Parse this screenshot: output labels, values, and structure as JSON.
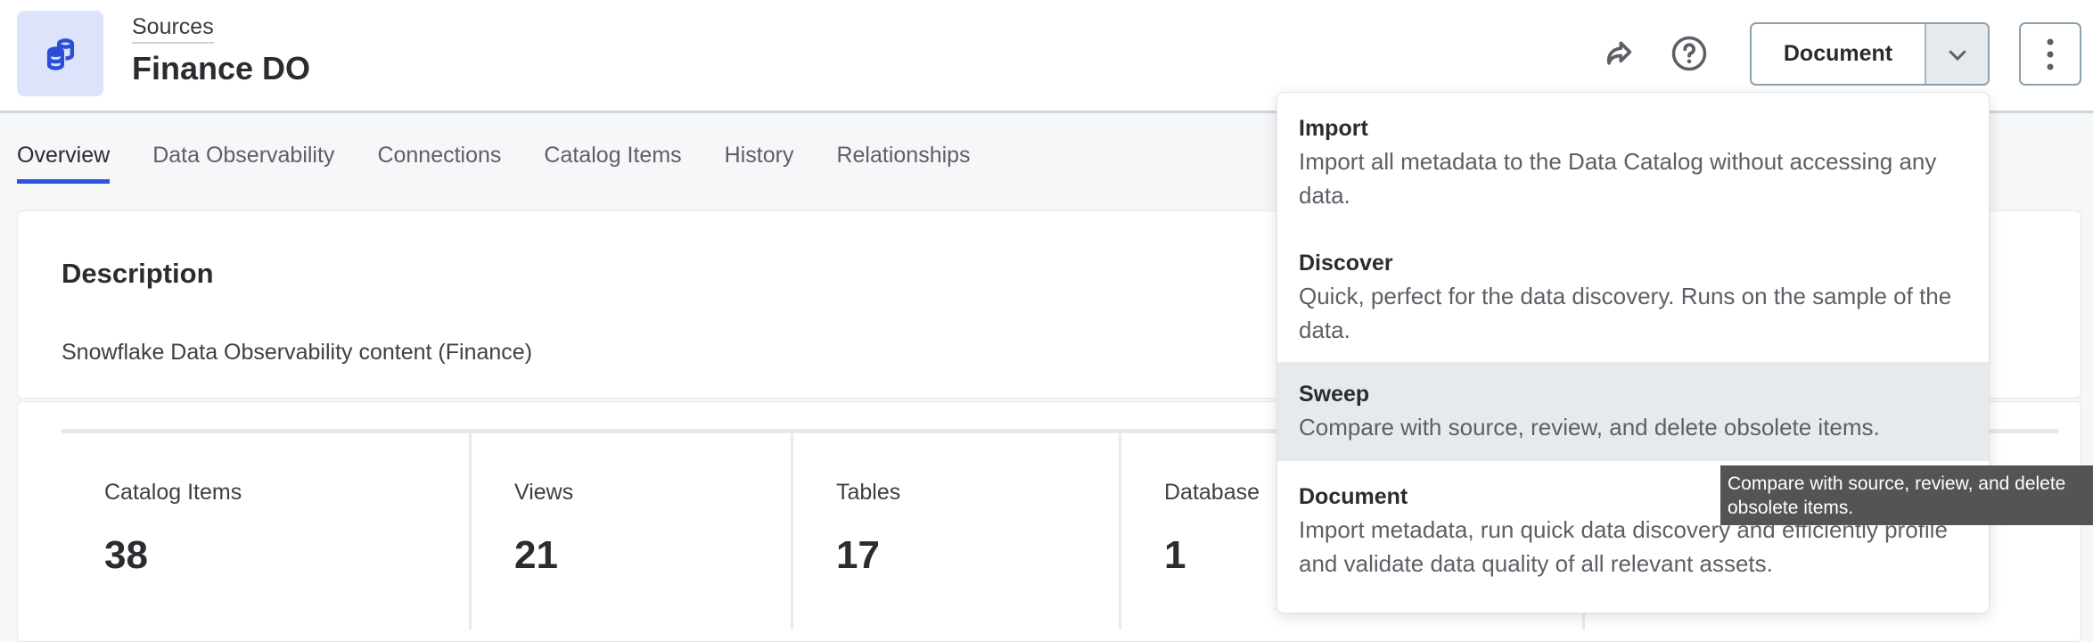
{
  "header": {
    "breadcrumb": "Sources",
    "title": "Finance DO",
    "logo_icon": "database-icon",
    "share_icon": "share-icon",
    "help_icon": "help-icon",
    "primary_action": "Document",
    "more_icon": "kebab-icon"
  },
  "tabs": [
    {
      "label": "Overview",
      "active": true
    },
    {
      "label": "Data Observability"
    },
    {
      "label": "Connections"
    },
    {
      "label": "Catalog Items"
    },
    {
      "label": "History"
    },
    {
      "label": "Relationships"
    }
  ],
  "description": {
    "heading": "Description",
    "text": "Snowflake Data Observability content (Finance)"
  },
  "stats": [
    {
      "label": "Catalog Items",
      "value": "38"
    },
    {
      "label": "Views",
      "value": "21"
    },
    {
      "label": "Tables",
      "value": "17"
    },
    {
      "label": "Database",
      "value": "1"
    }
  ],
  "menu": [
    {
      "title": "Import",
      "desc": "Import all metadata to the Data Catalog without accessing any data."
    },
    {
      "title": "Discover",
      "desc": "Quick, perfect for the data discovery. Runs on the sample of the data."
    },
    {
      "title": "Sweep",
      "desc": "Compare with source, review, and delete obsolete items."
    },
    {
      "title": "Document",
      "desc": "Import metadata, run quick data discovery and efficiently profile and validate data quality of all relevant assets."
    }
  ],
  "tooltip": "Compare with source, review, and delete obsolete items.",
  "colors": {
    "accent": "#2b54e0",
    "logo_bg": "#dde3fa",
    "highlight": "#e7eaed",
    "tooltip_bg": "#545454"
  }
}
